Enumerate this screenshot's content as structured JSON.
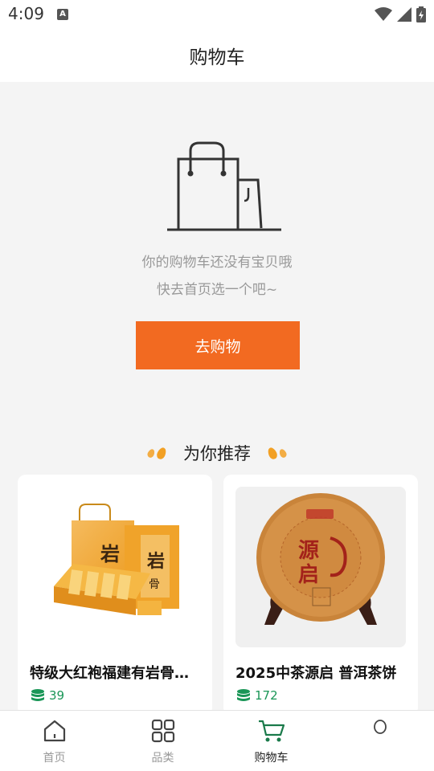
{
  "status_bar": {
    "time": "4:09",
    "notification_icon": "A"
  },
  "header": {
    "title": "购物车"
  },
  "empty_cart": {
    "line1": "你的购物车还没有宝贝哦",
    "line2": "快去首页选一个吧~",
    "button_label": "去购物"
  },
  "recommend": {
    "title": "为你推荐",
    "products": [
      {
        "name": "特级大红袍福建有岩骨花香",
        "price": "39"
      },
      {
        "name": "2025中茶源启 普洱茶饼",
        "price": "172"
      }
    ]
  },
  "tabbar": {
    "items": [
      {
        "label": "首页",
        "icon": "home-icon"
      },
      {
        "label": "品类",
        "icon": "grid-icon"
      },
      {
        "label": "购物车",
        "icon": "cart-icon"
      },
      {
        "label": "",
        "icon": "profile-icon"
      }
    ],
    "active_index": 2
  },
  "colors": {
    "accent": "#f26a21",
    "price_green": "#1a9657",
    "drop_orange": "#f2a024"
  }
}
